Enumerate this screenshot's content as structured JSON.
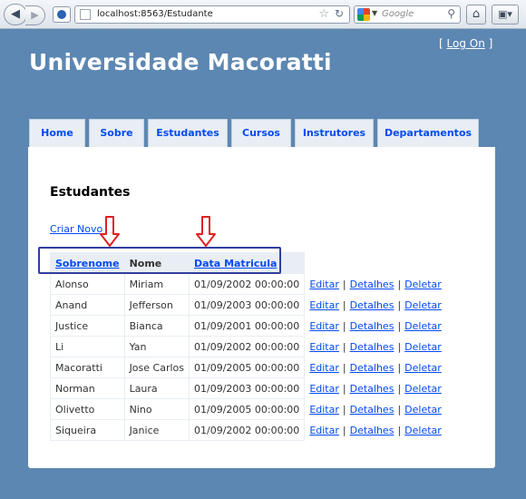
{
  "browser": {
    "url": "localhost:8563/Estudante",
    "search_placeholder": "Google"
  },
  "site": {
    "title": "Universidade Macoratti",
    "login_prefix": "[",
    "login_label": "Log On",
    "login_suffix": "]"
  },
  "nav": {
    "tabs": [
      "Home",
      "Sobre",
      "Estudantes",
      "Cursos",
      "Instrutores",
      "Departamentos"
    ]
  },
  "main": {
    "heading": "Estudantes",
    "create_link": "Criar Novo",
    "columns": [
      "Sobrenome",
      "Nome",
      "Data Matricula"
    ],
    "actions": [
      "Editar",
      "Detalhes",
      "Deletar"
    ],
    "separator": "|",
    "rows": [
      [
        "Alonso",
        "Miriam",
        "01/09/2002 00:00:00"
      ],
      [
        "Anand",
        "Jefferson",
        "01/09/2003 00:00:00"
      ],
      [
        "Justice",
        "Bianca",
        "01/09/2001 00:00:00"
      ],
      [
        "Li",
        "Yan",
        "01/09/2002 00:00:00"
      ],
      [
        "Macoratti",
        "Jose Carlos",
        "01/09/2005 00:00:00"
      ],
      [
        "Norman",
        "Laura",
        "01/09/2003 00:00:00"
      ],
      [
        "Olivetto",
        "Nino",
        "01/09/2005 00:00:00"
      ],
      [
        "Siqueira",
        "Janice",
        "01/09/2002 00:00:00"
      ]
    ]
  },
  "colors": {
    "page_background": "#5c87b2",
    "link": "#034af3",
    "tab_background": "#e8eef4",
    "annotation_arrow": "#e02020",
    "annotation_box": "#2e3f9e"
  }
}
